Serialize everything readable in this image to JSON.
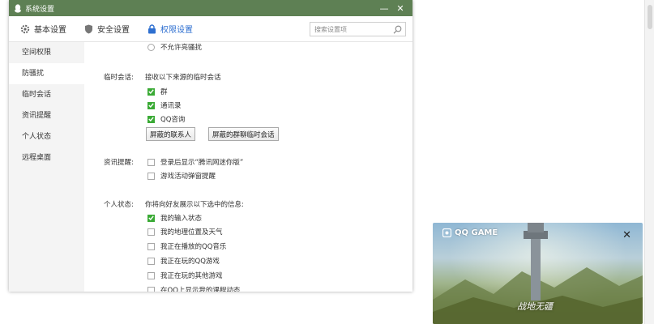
{
  "window": {
    "title": "系统设置",
    "minimize_glyph": "—",
    "close_glyph": "✕"
  },
  "tabs": [
    {
      "label": "基本设置",
      "icon": "gear-icon"
    },
    {
      "label": "安全设置",
      "icon": "shield-icon"
    },
    {
      "label": "权限设置",
      "icon": "lock-icon",
      "active": true
    }
  ],
  "search": {
    "placeholder": "搜索设置项"
  },
  "sidebar": {
    "items": [
      {
        "label": "空间权限"
      },
      {
        "label": "防骚扰",
        "active": true
      },
      {
        "label": "临时会话"
      },
      {
        "label": "资讯提醒"
      },
      {
        "label": "个人状态"
      },
      {
        "label": "远程桌面"
      }
    ]
  },
  "content": {
    "top_radio": {
      "label": "不允许亮骚扰"
    },
    "temp_chat": {
      "label": "临时会话:",
      "desc": "接收以下来源的临时会话",
      "options": [
        {
          "label": "群",
          "checked": true
        },
        {
          "label": "通讯录",
          "checked": true
        },
        {
          "label": "QQ咨询",
          "checked": true
        }
      ],
      "buttons": [
        "屏蔽的联系人",
        "屏蔽的群聊临时会话"
      ]
    },
    "news": {
      "label": "资讯提醒:",
      "options": [
        {
          "label": "登录后显示“腾讯网迷你版”",
          "checked": false
        },
        {
          "label": "游戏活动弹窗提醒",
          "checked": false
        }
      ]
    },
    "status": {
      "label": "个人状态:",
      "desc": "你将向好友展示以下选中的信息:",
      "options": [
        {
          "label": "我的输入状态",
          "checked": true
        },
        {
          "label": "我的地理位置及天气",
          "checked": false
        },
        {
          "label": "我正在播放的QQ音乐",
          "checked": false
        },
        {
          "label": "我正在玩的QQ游戏",
          "checked": false
        },
        {
          "label": "我正在玩的其他游戏",
          "checked": false
        },
        {
          "label": "在QQ上显示我的课程动态",
          "checked": false
        }
      ]
    }
  },
  "game_popup": {
    "brand": "QQ GAME",
    "close_glyph": "✕",
    "title": "战地无疆"
  },
  "colors": {
    "titlebar": "#5e8054",
    "accent": "#2e6fd0",
    "checkbox": "#3aaa35"
  }
}
